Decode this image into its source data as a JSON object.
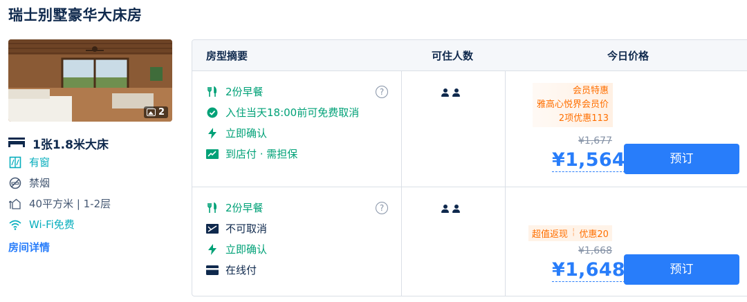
{
  "room": {
    "title": "瑞士别墅豪华大床房",
    "photo_count": "2",
    "bed": "1张1.8米大床",
    "features": [
      {
        "icon": "window-icon",
        "text": "有窗",
        "color": "#06aebd"
      },
      {
        "icon": "no-smoking-icon",
        "text": "禁烟",
        "color": "#455873"
      },
      {
        "icon": "area-icon",
        "text": "40平方米 | 1-2层",
        "color": "#455873"
      },
      {
        "icon": "wifi-icon",
        "text": "Wi-Fi免费",
        "color": "#06aebd"
      }
    ],
    "details_link": "房间详情"
  },
  "table": {
    "headers": {
      "summary": "房型摘要",
      "occupancy": "可住人数",
      "price": "今日价格"
    },
    "rates": [
      {
        "items": [
          {
            "icon": "breakfast-icon",
            "text": "2份早餐"
          },
          {
            "icon": "check-circle-icon",
            "text": "入住当天18:00前可免费取消"
          },
          {
            "icon": "lightning-icon",
            "text": "立即确认"
          },
          {
            "icon": "pay-at-hotel-icon",
            "text": "到店付 · 需担保"
          }
        ],
        "help": "?",
        "promo": [
          "会员特惠",
          "雅高心悦界会员价",
          "2项优惠113"
        ],
        "original_price": "¥1,677",
        "price": "¥1,564",
        "button": "预订"
      },
      {
        "items": [
          {
            "icon": "breakfast-icon",
            "text": "2份早餐"
          },
          {
            "icon": "no-cancel-icon",
            "text": "不可取消"
          },
          {
            "icon": "lightning-icon",
            "text": "立即确认"
          },
          {
            "icon": "card-icon",
            "text": "在线付"
          }
        ],
        "help": "?",
        "promo": [
          "超值返现",
          "优惠20"
        ],
        "original_price": "¥1,668",
        "price": "¥1,648",
        "button": "预订"
      }
    ]
  },
  "colors": {
    "accent": "#287dfa",
    "green": "#00a177",
    "promo": "#ff6f00"
  }
}
